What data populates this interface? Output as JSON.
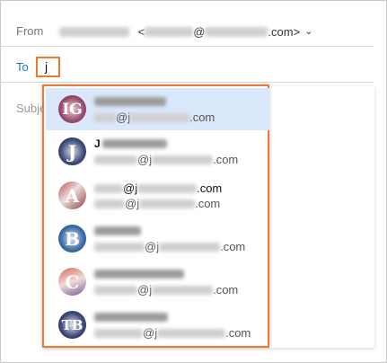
{
  "compose": {
    "from_label": "From",
    "from_angle_open": "<",
    "from_at": "@",
    "from_domain_suffix": ".com>",
    "from_chevron": "⌄",
    "to_label": "To",
    "to_value": "j",
    "subject_label": "Subje"
  },
  "autocomplete": {
    "items": [
      {
        "avatar_text": "IG",
        "avatar_color": "#8a3a5c",
        "name_prefix": "",
        "email_at": "@j",
        "email_suffix": ".com",
        "selected": true
      },
      {
        "avatar_text": "J",
        "avatar_color": "#2c3a5e",
        "name_prefix": "J",
        "email_at": "@j",
        "email_suffix": ".com",
        "selected": false
      },
      {
        "avatar_text": "A",
        "avatar_color": "#b83a3a",
        "name_prefix": "",
        "name_at": "@j",
        "name_suffix": ".com",
        "email_at": "@j",
        "email_suffix": ".com",
        "selected": false
      },
      {
        "avatar_text": "B",
        "avatar_color": "#2a5fa0",
        "name_prefix": "",
        "email_at": "@j",
        "email_suffix": ".com",
        "selected": false
      },
      {
        "avatar_text": "C",
        "avatar_color": "#b0504a",
        "name_prefix": "",
        "email_at": "@j",
        "email_suffix": ".com",
        "selected": false
      },
      {
        "avatar_text": "TB",
        "avatar_color": "#2a3560",
        "name_prefix": "",
        "email_at": "@j",
        "email_suffix": ".com",
        "selected": false
      }
    ]
  }
}
